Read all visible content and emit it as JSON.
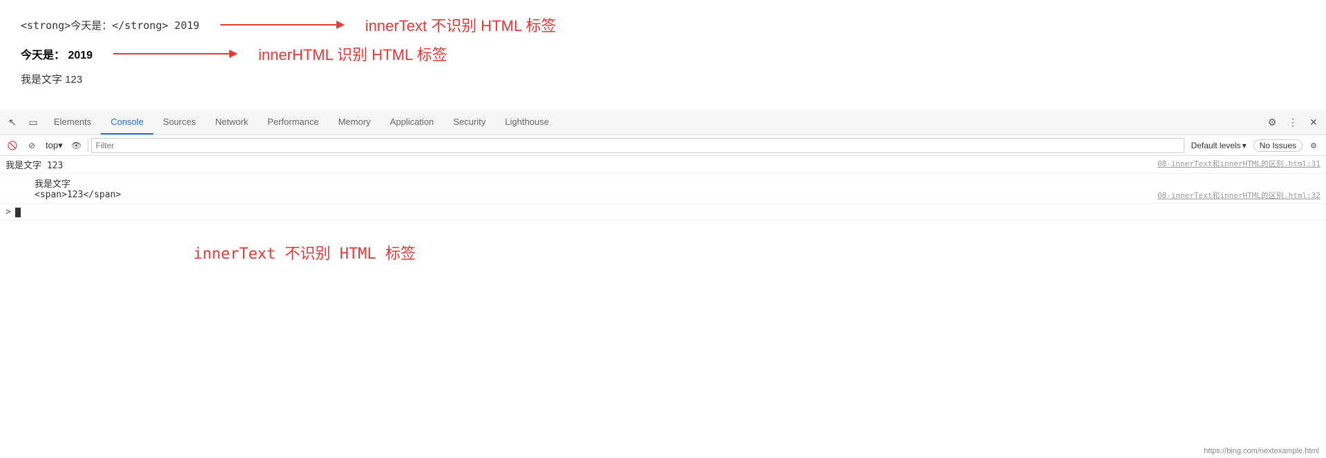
{
  "page": {
    "line1": {
      "code": "<strong>今天是：</strong> 2019",
      "arrow_label": "innerText 不识别 HTML 标签"
    },
    "line2": {
      "text": "今天是：  2019",
      "arrow_label": "innerHTML 识别 HTML 标签"
    },
    "line3": {
      "text": "我是文字 123"
    }
  },
  "devtools": {
    "tabs": [
      {
        "label": "Elements",
        "active": false
      },
      {
        "label": "Console",
        "active": true
      },
      {
        "label": "Sources",
        "active": false
      },
      {
        "label": "Network",
        "active": false
      },
      {
        "label": "Performance",
        "active": false
      },
      {
        "label": "Memory",
        "active": false
      },
      {
        "label": "Application",
        "active": false
      },
      {
        "label": "Security",
        "active": false
      },
      {
        "label": "Lighthouse",
        "active": false
      }
    ],
    "console_toolbar": {
      "top_label": "top",
      "filter_placeholder": "Filter",
      "default_levels": "Default levels",
      "no_issues": "No Issues"
    },
    "output": {
      "row1": {
        "text": "我是文字 123",
        "link": "08-innerText和innerHTML的区别.html:31"
      },
      "row2_line1": {
        "text": "我是文字"
      },
      "row2_line2": {
        "text": "<span>123</span>",
        "link": "08-innerText和innerHTML的区别.html:32"
      },
      "prompt": "> |"
    },
    "bottom_red": "innerText 不识别 HTML 标签"
  },
  "url": "https://bing.com/nextexample.html"
}
